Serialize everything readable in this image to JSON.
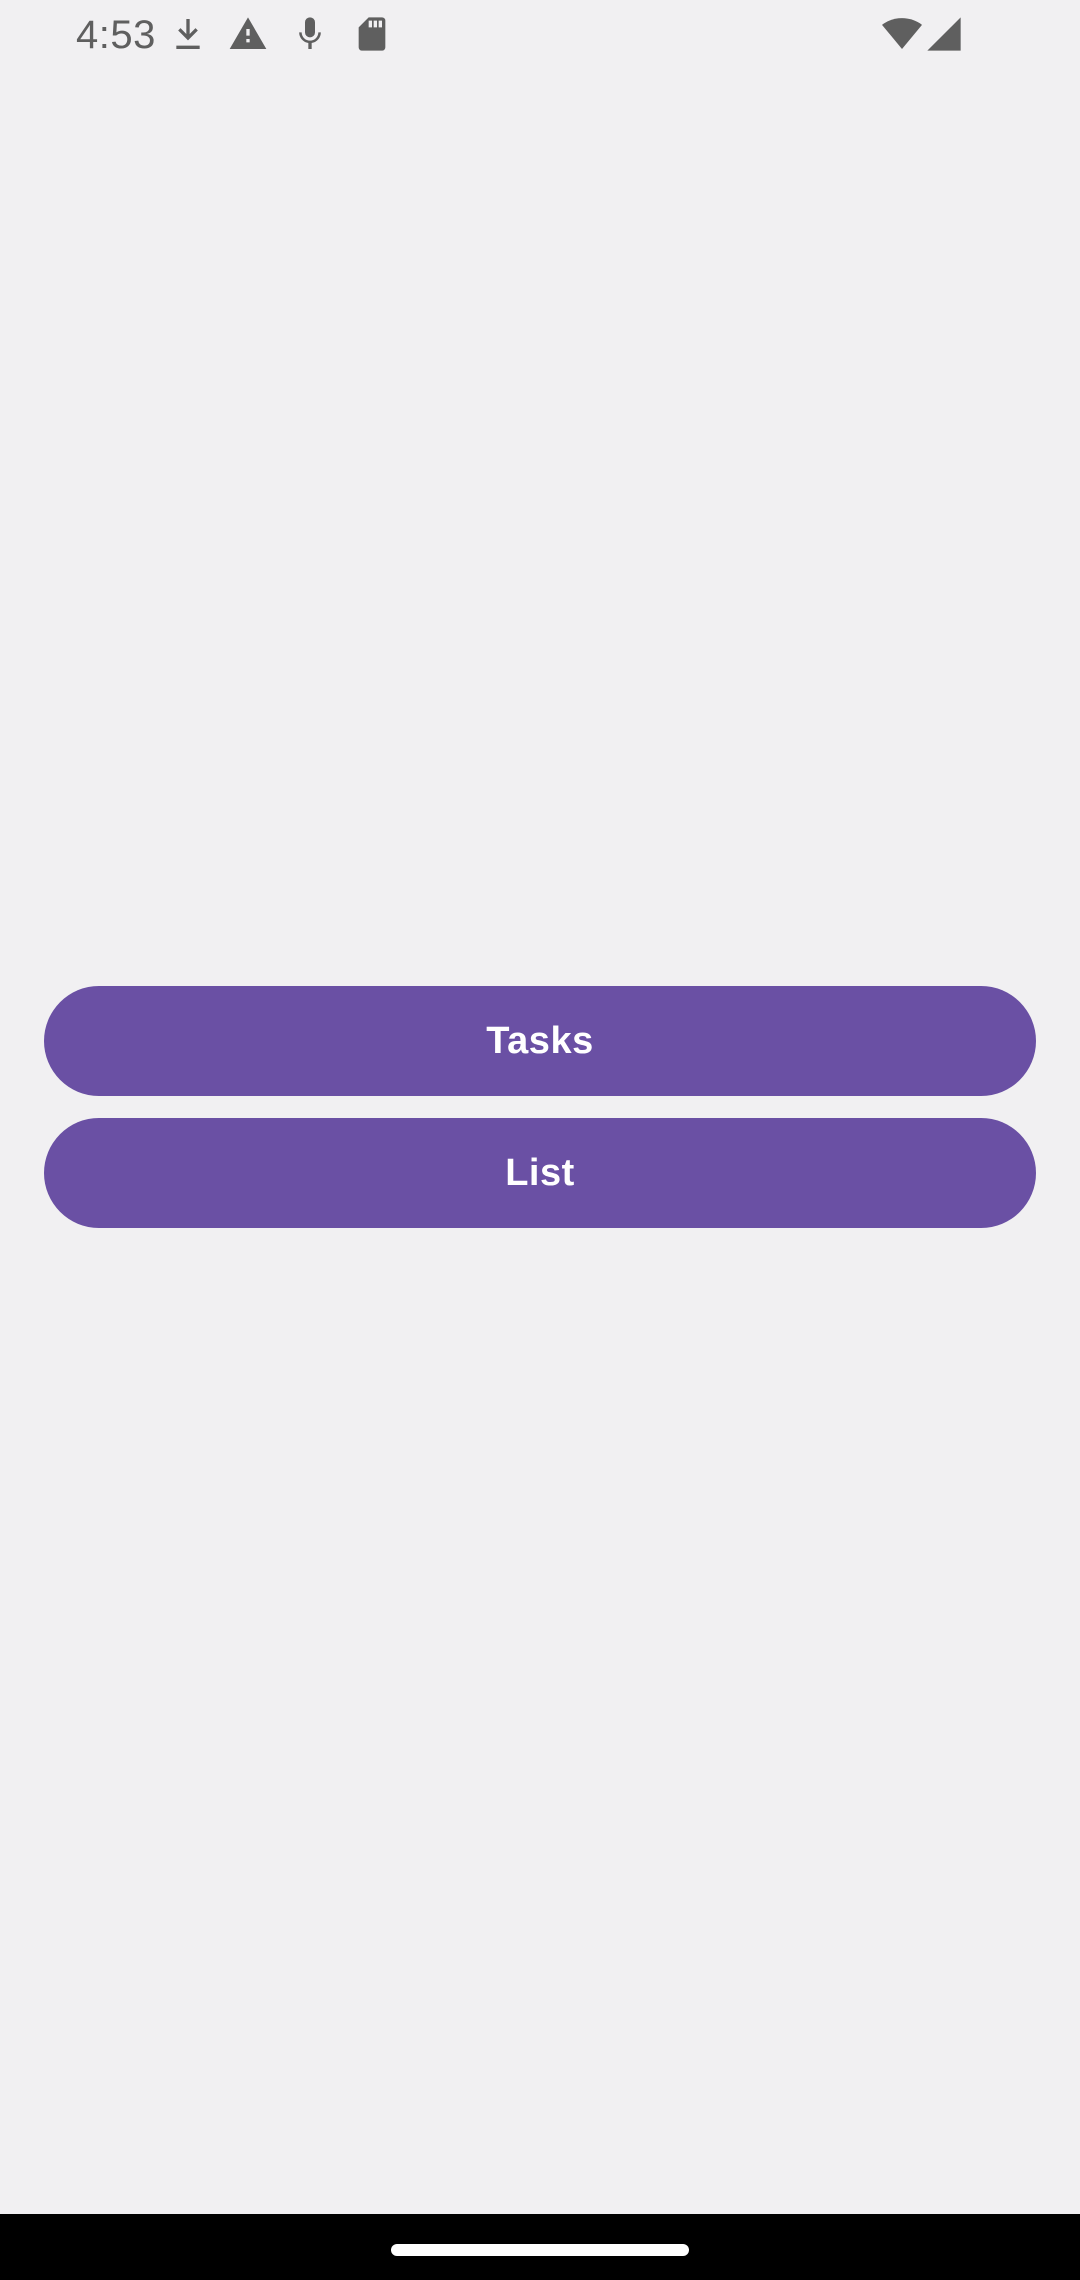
{
  "status_bar": {
    "time": "4:53",
    "left_icons": [
      "download-icon",
      "warning-icon",
      "mic-icon",
      "sd-card-icon"
    ],
    "right_icons": [
      "wifi-icon",
      "cell-signal-icon"
    ],
    "icon_color": "#5f5f5f"
  },
  "main": {
    "buttons": [
      {
        "label": "Tasks"
      },
      {
        "label": "List"
      }
    ],
    "button_color": "#6a50a4",
    "background_color": "#f1f0f2"
  },
  "nav_bar": {
    "color": "#000000"
  }
}
